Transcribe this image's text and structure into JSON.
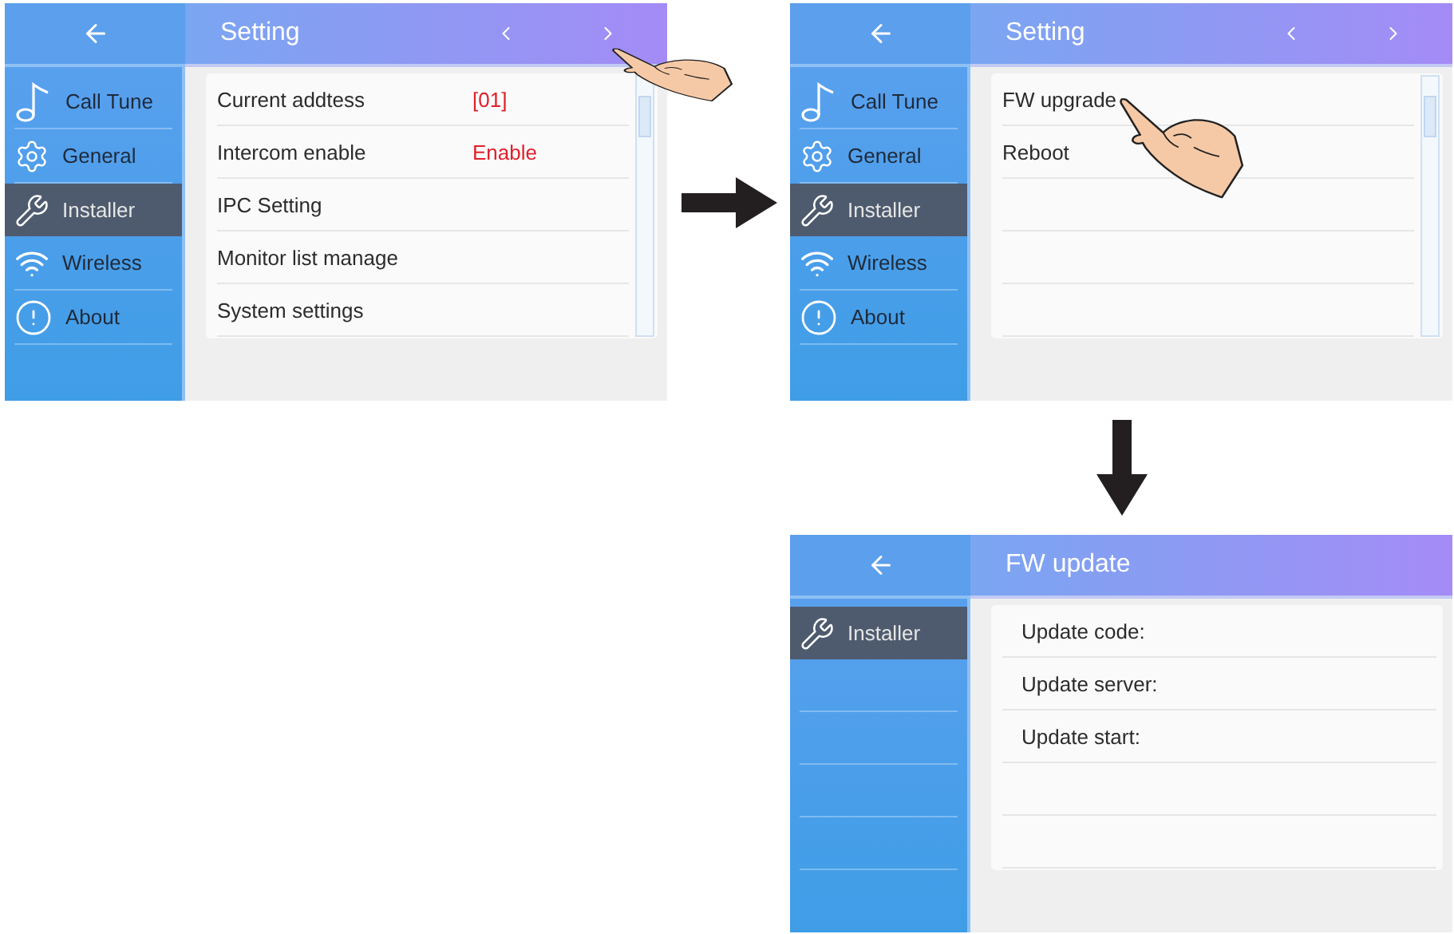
{
  "screens": [
    {
      "title": "Setting",
      "scrollbar": true,
      "nav": [
        {
          "kind": "prev",
          "touched": false
        },
        {
          "kind": "next",
          "touched": true
        }
      ],
      "sidebar": [
        {
          "kind": "note",
          "label": "Call Tune",
          "selected": false
        },
        {
          "kind": "gear",
          "label": "General",
          "selected": false
        },
        {
          "kind": "wrench",
          "label": "Installer",
          "selected": true
        },
        {
          "kind": "wifi",
          "label": "Wireless",
          "selected": false
        },
        {
          "kind": "info",
          "label": "About",
          "selected": false
        }
      ],
      "rows": [
        {
          "label": "Current addtess",
          "value": "[01]",
          "touched": false
        },
        {
          "label": "Intercom enable",
          "value": "Enable",
          "touched": false
        },
        {
          "label": "IPC Setting",
          "touched": false
        },
        {
          "label": "Monitor list manage",
          "touched": false
        },
        {
          "label": "System settings",
          "touched": false
        }
      ]
    },
    {
      "title": "Setting",
      "scrollbar": true,
      "nav": [
        {
          "kind": "prev",
          "touched": false
        },
        {
          "kind": "next",
          "touched": false
        }
      ],
      "sidebar": [
        {
          "kind": "note",
          "label": "Call Tune",
          "selected": false
        },
        {
          "kind": "gear",
          "label": "General",
          "selected": false
        },
        {
          "kind": "wrench",
          "label": "Installer",
          "selected": true
        },
        {
          "kind": "wifi",
          "label": "Wireless",
          "selected": false
        },
        {
          "kind": "info",
          "label": "About",
          "selected": false
        }
      ],
      "rows": [
        {
          "label": "FW upgrade",
          "touched": true
        },
        {
          "label": "Reboot",
          "touched": false
        }
      ]
    },
    {
      "title": "FW update",
      "scrollbar": false,
      "sidebar": [
        {
          "kind": "wrench",
          "label": "Installer",
          "selected": true
        }
      ],
      "rows": [
        {
          "label": "Update code:",
          "touched": false
        },
        {
          "label": "Update server:",
          "touched": false
        },
        {
          "label": "Update start:",
          "touched": false
        }
      ]
    }
  ]
}
